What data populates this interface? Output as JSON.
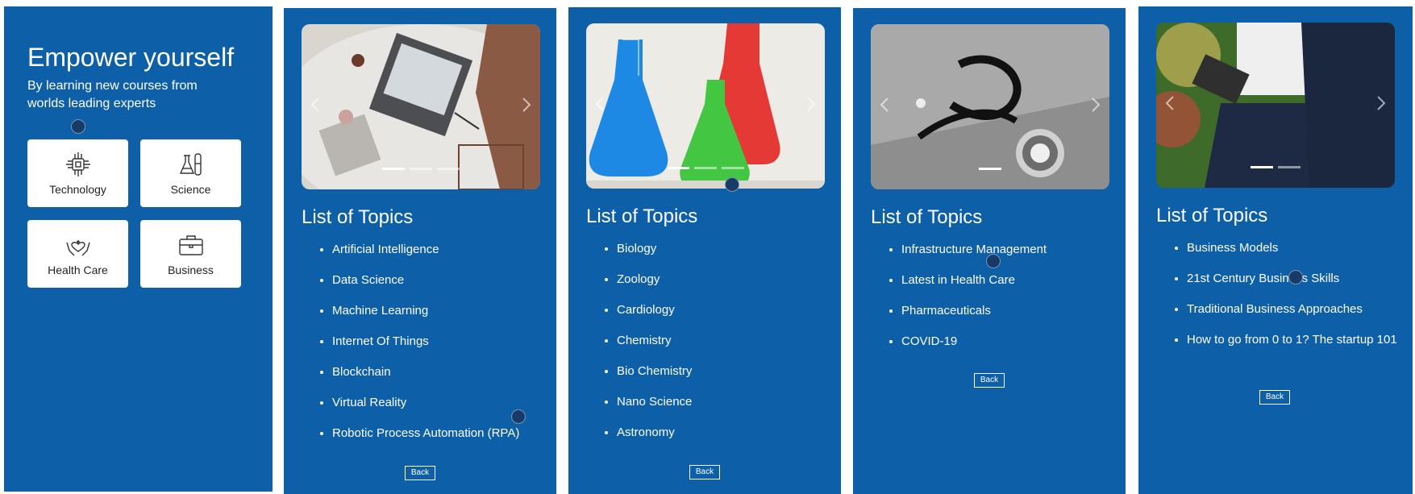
{
  "intro": {
    "title": "Empower yourself",
    "subtitle": "By learning new courses from worlds leading experts",
    "categories": [
      {
        "label": "Technology",
        "icon": "chip-icon"
      },
      {
        "label": "Science",
        "icon": "flask-icon"
      },
      {
        "label": "Health Care",
        "icon": "heart-hands-icon"
      },
      {
        "label": "Business",
        "icon": "briefcase-icon"
      }
    ]
  },
  "topics_heading": "List of Topics",
  "back_label": "Back",
  "panels": [
    {
      "image": "laptop-desk-photo",
      "topics": [
        "Artificial Intelligence",
        "Data Science",
        "Machine Learning",
        "Internet Of Things",
        "Blockchain",
        "Virtual Reality",
        "Robotic Process Automation (RPA)"
      ]
    },
    {
      "image": "chemistry-flasks-photo",
      "topics": [
        "Biology",
        "Zoology",
        "Cardiology",
        "Chemistry",
        "Bio Chemistry",
        "Nano Science",
        "Astronomy"
      ]
    },
    {
      "image": "stethoscope-photo",
      "topics": [
        "Infrastructure Management",
        "Latest in Health Care",
        "Pharmaceuticals",
        "COVID-19"
      ]
    },
    {
      "image": "business-tablet-photo",
      "topics": [
        "Business Models",
        "21st Century Business Skills",
        "Traditional Business Approaches",
        "How to go from 0 to 1? The startup 101"
      ]
    }
  ],
  "colors": {
    "panel": "#0d5fa8",
    "card": "#ffffff"
  }
}
